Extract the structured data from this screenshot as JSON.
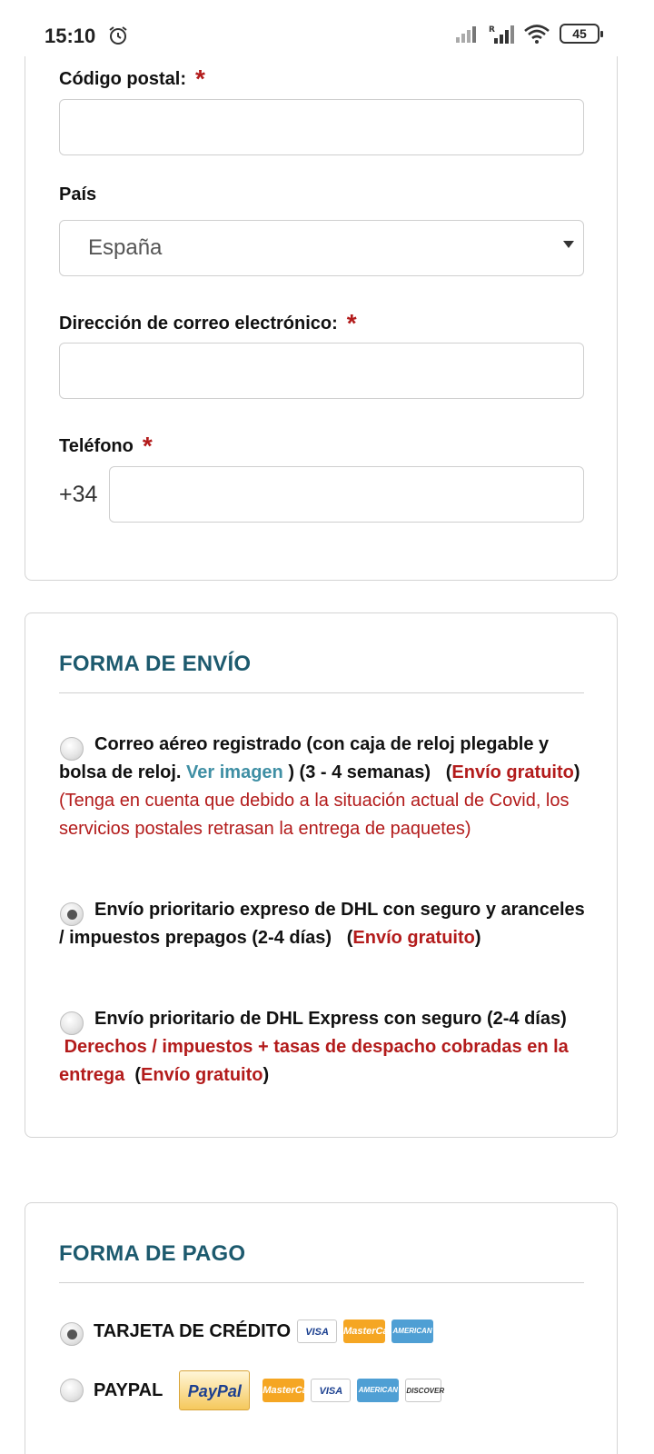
{
  "status_bar": {
    "time": "15:10",
    "battery": "45",
    "icons": [
      "alarm-icon",
      "signal-icon",
      "signal-roaming-icon",
      "wifi-icon",
      "battery-icon"
    ]
  },
  "address_form": {
    "postal_code_label": "Código postal:",
    "postal_code_value": "",
    "country_label": "País",
    "country_value": "España",
    "email_label": "Dirección de correo electrónico:",
    "email_value": "",
    "phone_label": "Teléfono",
    "phone_prefix": "+34",
    "phone_value": "",
    "required_marker": "*"
  },
  "shipping": {
    "title": "FORMA DE ENVÍO",
    "options": [
      {
        "selected": false,
        "text_1": "Correo aéreo registrado (con caja de reloj plegable y bolsa de reloj.",
        "link": "Ver imagen",
        "text_2": ") (3 - 4 semanas)",
        "free_open": "(",
        "free": "Envío gratuito",
        "free_close": ")",
        "note": "(Tenga en cuenta que debido a la situación actual de Covid, los servicios postales retrasan la entrega de paquetes)"
      },
      {
        "selected": true,
        "text_1": "Envío prioritario expreso de DHL con seguro y aranceles / impuestos prepagos (2-4 días)",
        "free_open": "(",
        "free": "Envío gratuito",
        "free_close": ")"
      },
      {
        "selected": false,
        "text_1": "Envío prioritario de DHL Express con seguro (2-4 días)",
        "duties": "Derechos / impuestos + tasas de despacho cobradas en la entrega",
        "free_open": "(",
        "free": "Envío gratuito",
        "free_close": ")"
      }
    ]
  },
  "payment": {
    "title": "FORMA DE PAGO",
    "options": [
      {
        "selected": true,
        "label": "TARJETA DE CRÉDITO",
        "logos": [
          "VISA",
          "MasterCard",
          "AMERICAN EXPRESS"
        ]
      },
      {
        "selected": false,
        "label": "PAYPAL",
        "button": "PayPal",
        "logos": [
          "MasterCard",
          "VISA",
          "AMERICAN EXPRESS",
          "DISCOVER"
        ]
      }
    ]
  },
  "colors": {
    "accent_title": "#1d5a6e",
    "required_red": "#b31b1b",
    "link": "#3f8fa4"
  }
}
